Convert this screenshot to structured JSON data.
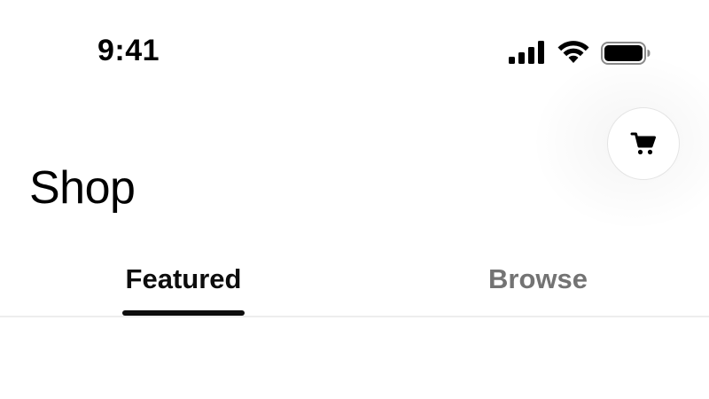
{
  "status_bar": {
    "time": "9:41",
    "icons": [
      "signal-icon",
      "wifi-icon",
      "battery-icon"
    ]
  },
  "header": {
    "title": "Shop",
    "cart_button_icon": "cart-icon"
  },
  "tabs": [
    {
      "label": "Featured",
      "selected": true
    },
    {
      "label": "Browse",
      "selected": false
    }
  ],
  "colors": {
    "background": "#ffffff",
    "text_primary": "#0d0d0d",
    "text_secondary": "#737373",
    "divider": "#ededed",
    "indicator": "#0d0d0d"
  }
}
